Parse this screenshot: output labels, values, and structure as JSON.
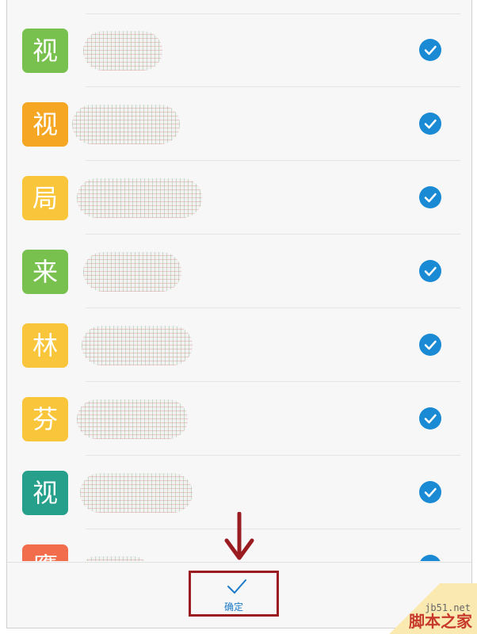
{
  "contacts": [
    {
      "initial": "视",
      "color": "#79c14f"
    },
    {
      "initial": "视",
      "color": "#f5a623"
    },
    {
      "initial": "局",
      "color": "#f9c53a"
    },
    {
      "initial": "来",
      "color": "#79c14f"
    },
    {
      "initial": "林",
      "color": "#f9c53a"
    },
    {
      "initial": "芬",
      "color": "#f9c53a"
    },
    {
      "initial": "视",
      "color": "#26a08a"
    },
    {
      "initial": "鹰",
      "color": "#f26d4b"
    }
  ],
  "colors": {
    "check": "#1a8ad4",
    "highlight": "#9b1c20",
    "accent": "#1a7ac8"
  },
  "bottom_bar": {
    "confirm_label": "确定"
  },
  "watermark": {
    "site": "jb51.net",
    "name": "脚本之家"
  }
}
